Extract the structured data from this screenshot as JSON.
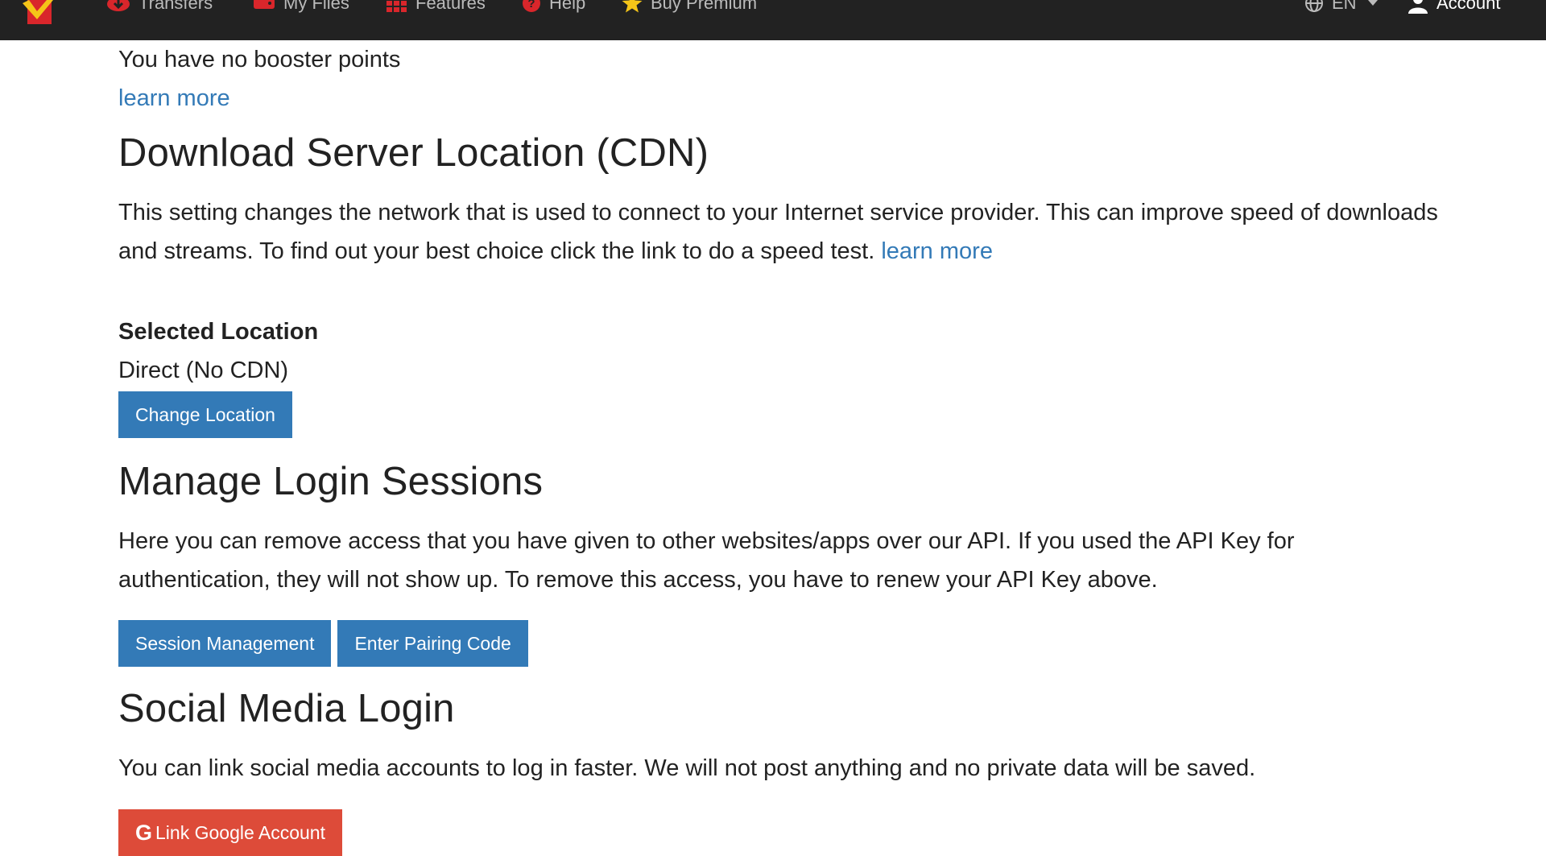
{
  "navbar": {
    "items": [
      {
        "label": "Transfers",
        "icon": "cloud-download-icon"
      },
      {
        "label": "My Files",
        "icon": "hard-drive-icon"
      },
      {
        "label": "Features",
        "icon": "grid-icon"
      },
      {
        "label": "Help",
        "icon": "question-circle-icon"
      },
      {
        "label": "Buy Premium",
        "icon": "star-icon"
      }
    ],
    "language": "EN",
    "account": "Account",
    "colors": {
      "background": "#222222",
      "icon_red": "#d9262b",
      "star": "#f5c518"
    }
  },
  "booster": {
    "text": "You have no booster points",
    "link": "learn more"
  },
  "cdn": {
    "title": "Download Server Location (CDN)",
    "description": "This setting changes the network that is used to connect to your Internet service provider. This can improve speed of downloads and streams. To find out your best choice click the link to do a speed test.",
    "link": "learn more",
    "selected_label": "Selected Location",
    "selected_value": "Direct (No CDN)",
    "button": "Change Location"
  },
  "sessions": {
    "title": "Manage Login Sessions",
    "description": "Here you can remove access that you have given to other websites/apps over our API. If you used the API Key for authentication, they will not show up. To remove this access, you have to renew your API Key above.",
    "buttons": [
      "Session Management",
      "Enter Pairing Code"
    ]
  },
  "social": {
    "title": "Social Media Login",
    "description": "You can link social media accounts to log in faster. We will not post anything and no private data will be saved.",
    "button": "Link Google Account",
    "button_icon": "google-icon"
  },
  "colors": {
    "link": "#337ab7",
    "primary_button": "#337ab7",
    "google_button": "#dd4b39",
    "text": "#222222"
  }
}
